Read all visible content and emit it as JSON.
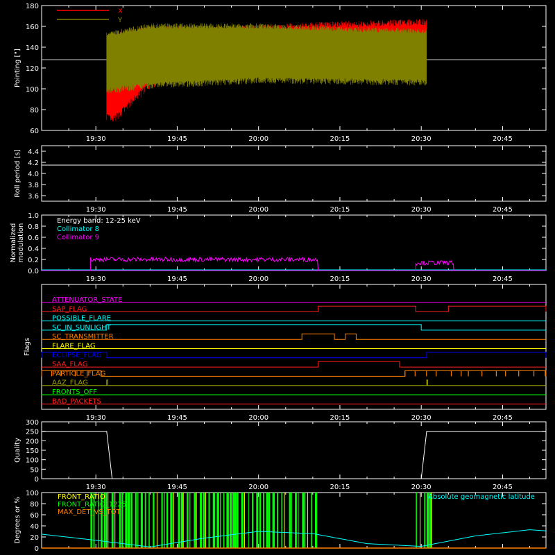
{
  "x_ticks": [
    "19:30",
    "19:45",
    "20:00",
    "20:15",
    "20:30",
    "20:45"
  ],
  "colors": {
    "x": "#ff0000",
    "y": "#808000",
    "cyan": "#00ffff",
    "magenta": "#ff00ff",
    "red": "#ff2020",
    "yellow": "#ffff00",
    "orange": "#ff8000",
    "blue": "#0000ff",
    "olive": "#a0a000",
    "green": "#00ff00",
    "white": "#ffffff"
  },
  "chart_data": [
    {
      "type": "line",
      "ylabel": "Pointing [\"]",
      "y_ticks": [
        "60",
        "80",
        "100",
        "120",
        "140",
        "160",
        "180"
      ],
      "ylim": [
        60,
        180
      ],
      "reference_line": 128,
      "legend": [
        {
          "label": "X",
          "color": "#ff0000"
        },
        {
          "label": "Y",
          "color": "#808000"
        }
      ],
      "data_span": [
        "19:32",
        "20:31"
      ],
      "x_envelope": {
        "t": [
          "19:32",
          "19:33",
          "19:40",
          "19:50",
          "20:00",
          "20:15",
          "20:30"
        ],
        "min": [
          70,
          65,
          100,
          115,
          120,
          120,
          118
        ],
        "max": [
          152,
          155,
          160,
          160,
          162,
          165,
          167
        ]
      },
      "y_envelope": {
        "t": [
          "19:32",
          "19:40",
          "20:00",
          "20:15",
          "20:30"
        ],
        "min": [
          95,
          100,
          105,
          104,
          103
        ],
        "max": [
          155,
          163,
          163,
          160,
          158
        ]
      }
    },
    {
      "type": "line",
      "ylabel": "Roll period [s]",
      "y_ticks": [
        "3.6",
        "3.8",
        "4.0",
        "4.2",
        "4.4"
      ],
      "ylim": [
        3.5,
        4.5
      ],
      "value": 4.15
    },
    {
      "type": "line",
      "ylabel": "Normalized modulation",
      "ylabel_lines": [
        "Normalized",
        "modulation"
      ],
      "y_ticks": [
        "0.0",
        "0.2",
        "0.4",
        "0.6",
        "0.8",
        "1.0"
      ],
      "ylim": [
        0,
        1
      ],
      "annotation": "Energy band: 12-25 keV",
      "legend": [
        {
          "label": "Collimator 8",
          "color": "#00ffff"
        },
        {
          "label": "Collimator 9",
          "color": "#ff00ff"
        }
      ],
      "segments": [
        {
          "start": "19:29",
          "end": "20:11",
          "mean": 0.2
        },
        {
          "start": "20:29",
          "end": "20:36",
          "mean": 0.14
        }
      ]
    },
    {
      "type": "timeline",
      "ylabel": "Flags",
      "flags": [
        {
          "name": "ATTENUATOR_STATE",
          "color": "#ff00ff",
          "on": []
        },
        {
          "name": "SAP_FLAG",
          "color": "#ff2020",
          "on": [
            [
              "20:11",
              "20:29"
            ],
            [
              "20:35",
              "20:53"
            ]
          ]
        },
        {
          "name": "POSSIBLE_FLARE",
          "color": "#00ffff",
          "on": []
        },
        {
          "name": "SC_IN_SUNLIGHT",
          "color": "#00ffff",
          "on": [
            [
              "19:32",
              "20:30"
            ]
          ]
        },
        {
          "name": "SC_TRANSMITTER",
          "color": "#ff8000",
          "on": [
            [
              "20:08",
              "20:14"
            ],
            [
              "20:16",
              "20:18"
            ]
          ]
        },
        {
          "name": "FLARE_FLAG",
          "color": "#ffff00",
          "on": []
        },
        {
          "name": "ECLIPSE_FLAG",
          "color": "#0000ff",
          "on": [
            [
              "19:20",
              "19:32"
            ],
            [
              "20:31",
              "20:53"
            ]
          ]
        },
        {
          "name": "SAA_FLAG",
          "color": "#ff2020",
          "on": [
            [
              "20:11",
              "20:26"
            ]
          ]
        },
        {
          "name": "PARTICLE_FLAG",
          "color": "#ff8000",
          "on": [
            [
              "19:20",
              "19:31"
            ],
            [
              "20:27",
              "20:53"
            ]
          ]
        },
        {
          "name": "AAZ_FLAG",
          "color": "#a0a000",
          "on": [
            [
              "19:32",
              "19:32"
            ],
            [
              "20:31",
              "20:31"
            ]
          ]
        },
        {
          "name": "FRONTS_OFF",
          "color": "#00ff00",
          "on": []
        },
        {
          "name": "BAD_PACKETS",
          "color": "#ff2020",
          "on": []
        }
      ]
    },
    {
      "type": "line",
      "ylabel": "Quality",
      "y_ticks": [
        "0",
        "50",
        "100",
        "150",
        "200",
        "250",
        "300"
      ],
      "ylim": [
        0,
        300
      ],
      "x": [
        "19:20",
        "19:32",
        "19:33",
        "20:30",
        "20:31",
        "20:53"
      ],
      "y": [
        250,
        250,
        0,
        0,
        250,
        250
      ]
    },
    {
      "type": "area",
      "ylabel": "Degrees or %",
      "y_ticks": [
        "0",
        "20",
        "40",
        "60",
        "80",
        "100"
      ],
      "ylim": [
        0,
        100
      ],
      "legend": [
        {
          "label": "FRONT_RATIO",
          "color": "#ffff00"
        },
        {
          "label": "FRONT_RATIO_1225",
          "color": "#00ff00"
        },
        {
          "label": "MAX_DET_VS_TOT",
          "color": "#ff8000"
        }
      ],
      "annotation": "Absolute geomagnetic latitude",
      "green_spans": [
        [
          "19:29",
          "20:11"
        ],
        [
          "20:29",
          "20:32"
        ]
      ],
      "latitude": {
        "t": [
          "19:20",
          "19:30",
          "19:40",
          "19:50",
          "20:00",
          "20:10",
          "20:20",
          "20:30",
          "20:40",
          "20:50",
          "20:53"
        ],
        "y": [
          25,
          14,
          2,
          18,
          30,
          26,
          8,
          3,
          22,
          33,
          31
        ]
      }
    }
  ]
}
